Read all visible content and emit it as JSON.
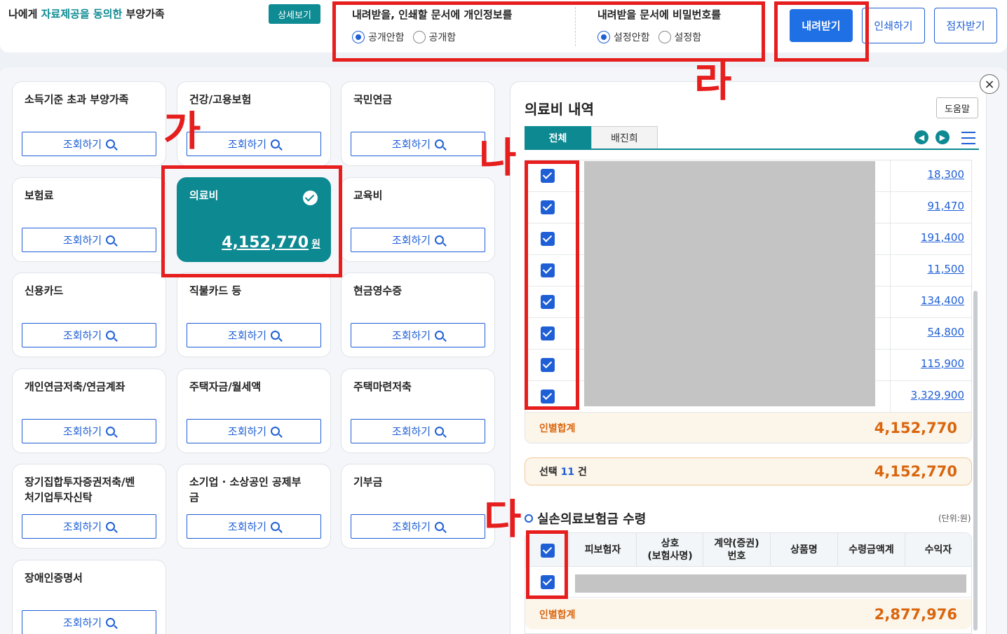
{
  "header": {
    "title_pre": "나에게 ",
    "title_highlight": "자료제공을 동의한",
    "title_post": " 부양가족",
    "detail_button": "상세보기",
    "privacy": {
      "label": "내려받을, 인쇄할 문서에 개인정보를",
      "options": [
        "공개안함",
        "공개함"
      ],
      "selected": "공개안함"
    },
    "password": {
      "label": "내려받을 문서에 비밀번호를",
      "options": [
        "설정안함",
        "설정함"
      ],
      "selected": "설정안함"
    },
    "download_button": "내려받기",
    "print_button": "인쇄하기",
    "braille_button": "점자받기"
  },
  "cards": [
    {
      "title": "소득기준 초과 부양가족",
      "button": "조회하기"
    },
    {
      "title": "건강/고용보험",
      "button": "조회하기"
    },
    {
      "title": "국민연금",
      "button": "조회하기"
    },
    {
      "title": "보험료",
      "button": "조회하기"
    },
    {
      "title": "의료비",
      "amount": "4,152,770",
      "unit": "원"
    },
    {
      "title": "교육비",
      "button": "조회하기"
    },
    {
      "title": "신용카드",
      "button": "조회하기"
    },
    {
      "title": "직불카드 등",
      "button": "조회하기"
    },
    {
      "title": "현금영수증",
      "button": "조회하기"
    },
    {
      "title": "개인연금저축/연금계좌",
      "button": "조회하기"
    },
    {
      "title": "주택자금/월세액",
      "button": "조회하기"
    },
    {
      "title": "주택마련저축",
      "button": "조회하기"
    },
    {
      "title": "장기집합투자증권저축/벤처기업투자신탁",
      "button": "조회하기"
    },
    {
      "title": "소기업 · 소상공인 공제부금",
      "button": "조회하기"
    },
    {
      "title": "기부금",
      "button": "조회하기"
    },
    {
      "title": "장애인증명서",
      "button": "조회하기"
    }
  ],
  "panel": {
    "title": "의료비 내역",
    "help_button": "도움말",
    "close_icon": "×",
    "tabs": [
      "전체",
      "배진희"
    ],
    "amounts": [
      "18,300",
      "91,470",
      "191,400",
      "11,500",
      "134,400",
      "54,800",
      "115,900",
      "3,329,900"
    ],
    "subtotal_label": "인별합계",
    "subtotal_value": "4,152,770",
    "selected_label": "선택",
    "selected_count": "11",
    "selected_unit": "건",
    "selected_value": "4,152,770",
    "insurance": {
      "title": "실손의료보험금 수령",
      "unit_note": "(단위:원)",
      "columns": [
        "피보험자",
        "상호\n(보험사명)",
        "계약(증권)\n번호",
        "상품명",
        "수령금액계",
        "수익자"
      ],
      "subtotal_label": "인별합계",
      "subtotal_value": "2,877,976"
    }
  },
  "annotations": [
    "가",
    "나",
    "다",
    "라"
  ],
  "colors": {
    "teal": "#0d8992",
    "blue": "#1f5fd6",
    "orange": "#d9660e",
    "red": "#e61e1e"
  }
}
